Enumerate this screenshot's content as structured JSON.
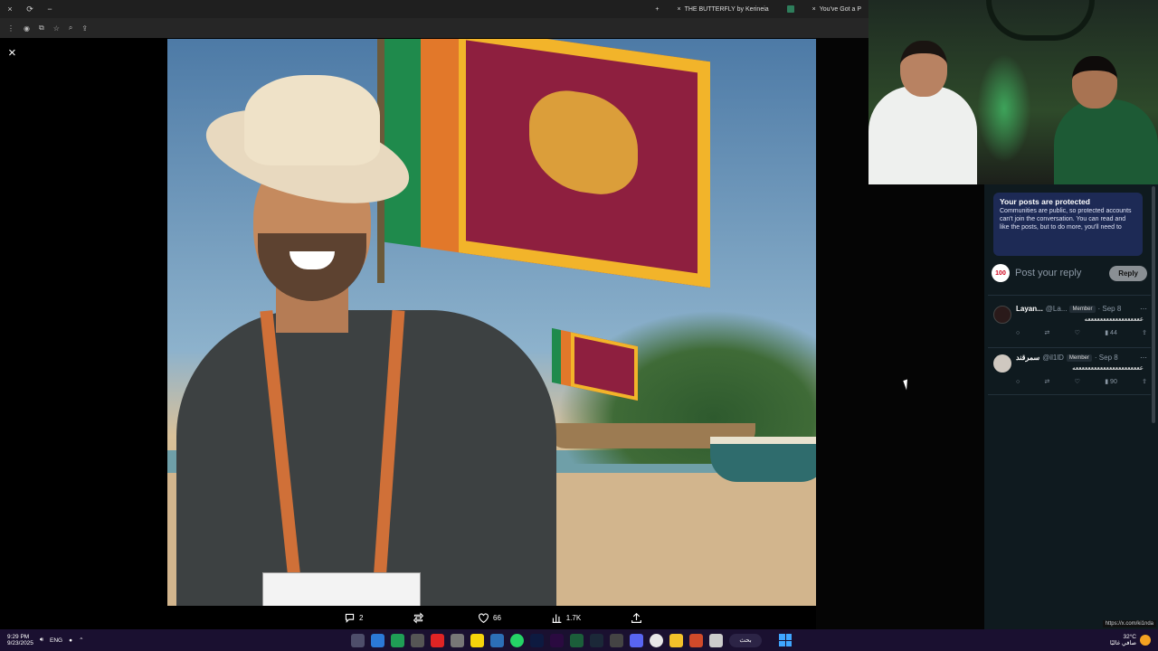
{
  "browser": {
    "tabs": [
      {
        "label": "THE BUTTERFLY by Kerineia"
      },
      {
        "label": "You've Got a P"
      }
    ],
    "new_tab": "+",
    "tab_close": "×",
    "window_close": "×",
    "window_reload": "⟳",
    "window_min": "−"
  },
  "viewer": {
    "close": "×",
    "actions": {
      "replies": "2",
      "reposts": "",
      "likes": "66",
      "views": "1.7K"
    }
  },
  "panel": {
    "notice": {
      "title": "Your posts are protected",
      "body": "Communities are public, so protected accounts can't join the conversation. You can read and like the posts, but to do more, you'll need to"
    },
    "compose": {
      "emoji": "100",
      "placeholder": "Post your reply",
      "reply_button": "Reply"
    },
    "replies": [
      {
        "name": "Layan...",
        "handle": "@La...",
        "badge": "Member",
        "date": "· Sep 8",
        "text": "ععععععععععععععععععه",
        "views": "44",
        "avatar_color": "#2a1a1a"
      },
      {
        "name": "سمرقند",
        "handle": "@il1lD",
        "badge": "Member",
        "date": "· Sep 8",
        "text": "ععععععععععععععععععععععه",
        "views": "90",
        "avatar_color": "#cfc8c0"
      }
    ]
  },
  "status_url": "https://x.com/ki1nda",
  "taskbar": {
    "time": "9:29 PM",
    "date": "9/23/2025",
    "lang": "ENG",
    "search": "بحث",
    "weather_temp": "32°C",
    "weather_desc": "صافي غالبًا"
  },
  "colors": {
    "accent": "#1d9bf0",
    "notice_bg": "#1d2a55",
    "panel_bg": "#0f1a1f",
    "taskbar_bg": "#1a1030"
  }
}
